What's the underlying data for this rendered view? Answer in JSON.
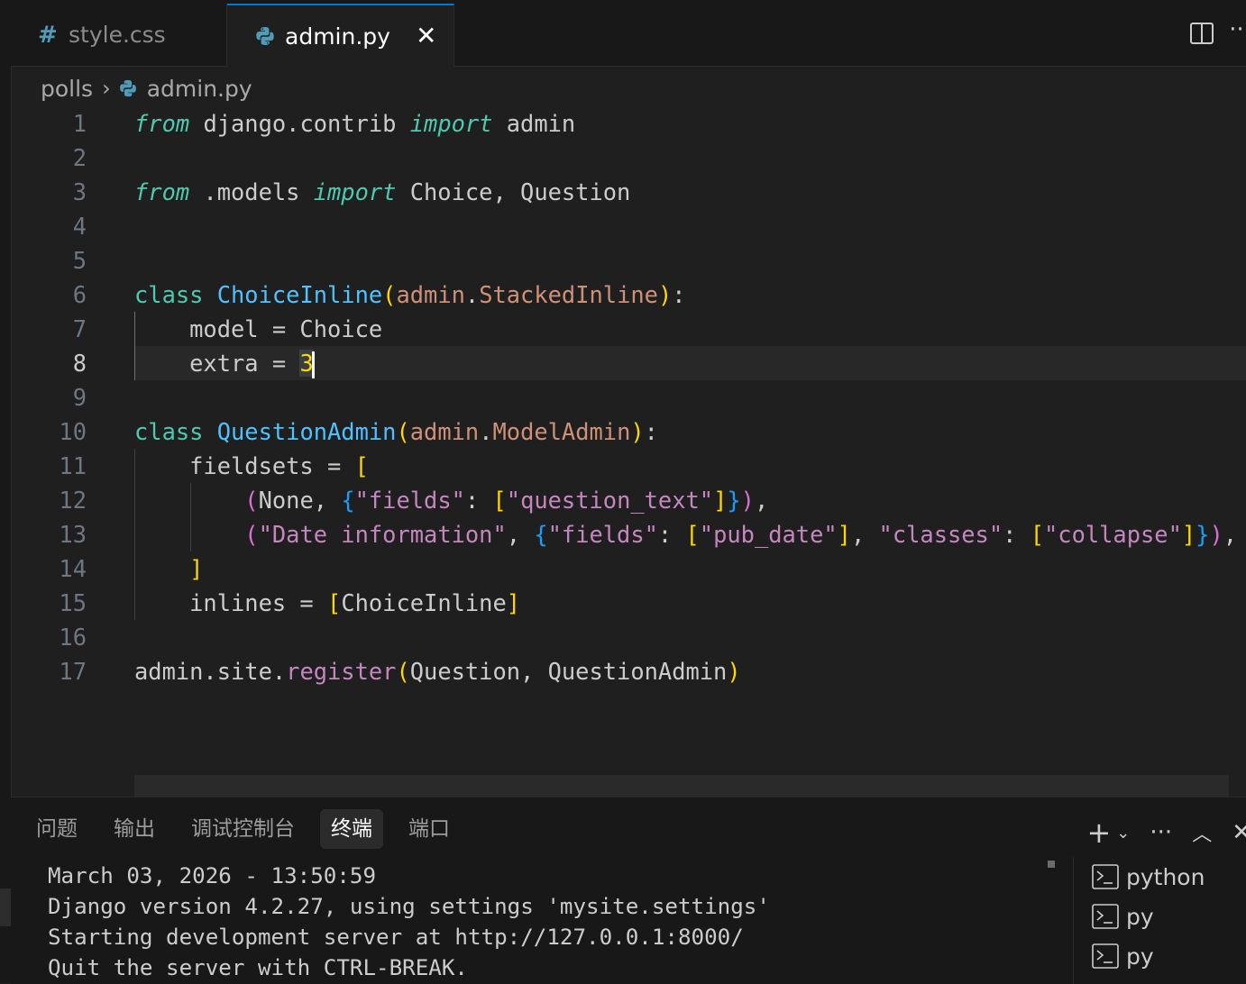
{
  "tabs": [
    {
      "icon": "css-hash-icon",
      "label": "style.css",
      "active": false
    },
    {
      "icon": "python-icon",
      "label": "admin.py",
      "active": true
    }
  ],
  "breadcrumb": {
    "folder": "polls",
    "file": "admin.py"
  },
  "editor": {
    "active_line": 8,
    "line_numbers": [
      "1",
      "2",
      "3",
      "4",
      "5",
      "6",
      "7",
      "8",
      "9",
      "10",
      "11",
      "12",
      "13",
      "14",
      "15",
      "16",
      "17"
    ]
  },
  "panel": {
    "tabs": [
      "问题",
      "输出",
      "调试控制台",
      "终端",
      "端口"
    ],
    "active_tab": "终端",
    "terminal_lines": [
      "March 03, 2026 - 13:50:59",
      "Django version 4.2.27, using settings 'mysite.settings'",
      "Starting development server at http://127.0.0.1:8000/",
      "Quit the server with CTRL-BREAK."
    ],
    "terminals": [
      "python",
      "py",
      "py"
    ]
  },
  "colors": {
    "accent": "#0078d4",
    "background": "#1f1f1f"
  }
}
